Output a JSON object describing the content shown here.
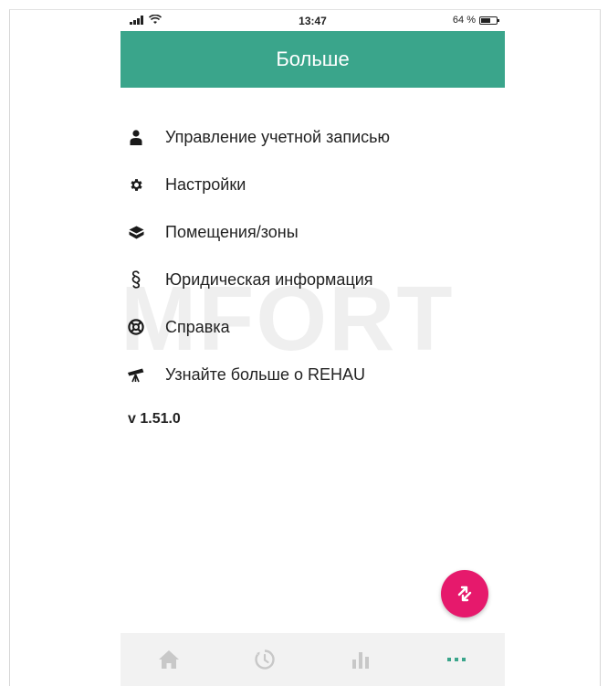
{
  "status_bar": {
    "time": "13:47",
    "battery_percent_text": "64 %",
    "battery_level": 0.64
  },
  "header": {
    "title": "Больше"
  },
  "menu": {
    "items": [
      {
        "label": "Управление учетной записью",
        "icon": "person-icon"
      },
      {
        "label": "Настройки",
        "icon": "gear-icon"
      },
      {
        "label": "Помещения/зоны",
        "icon": "cube-icon"
      },
      {
        "label": "Юридическая информация",
        "icon": "section-sign-icon"
      },
      {
        "label": "Справка",
        "icon": "lifebuoy-icon"
      },
      {
        "label": "Узнайте больше о REHAU",
        "icon": "telescope-icon"
      }
    ]
  },
  "version": "v 1.51.0",
  "watermark": "MFORT",
  "tabbar": {
    "tabs": [
      {
        "icon": "home-icon",
        "active": false
      },
      {
        "icon": "timer-icon",
        "active": false
      },
      {
        "icon": "statistics-icon",
        "active": false
      },
      {
        "icon": "more-dots-icon",
        "active": true
      }
    ]
  },
  "colors": {
    "header": "#3aa58b",
    "fab": "#e6196c",
    "tab_inactive": "#c8c8c8",
    "tab_active": "#3aa58b"
  }
}
